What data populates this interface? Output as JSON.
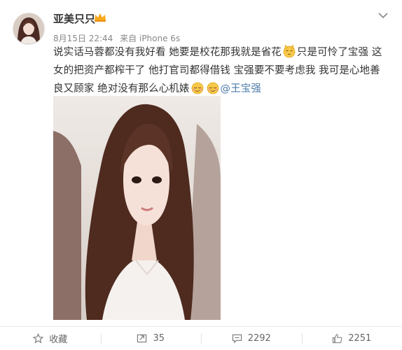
{
  "header": {
    "username": "亚美只只",
    "date": "8月15日 22:44",
    "source_prefix": "来自",
    "source": "iPhone 6s"
  },
  "post": {
    "segments": [
      {
        "text": "说实话马蓉都没有我好看  她要是校花那我就是省花"
      },
      {
        "emoji": "cat-face-icon"
      },
      {
        "text": "只是可怜了宝强  这女的把资产都榨干了  他打官司都得借钱  宝强要不要考虑我  我可是心地善良又顾家  绝对没有那么心机婊"
      },
      {
        "emoji": "smirk-face-icon"
      },
      {
        "emoji": "smirk-face-icon"
      },
      {
        "mention": "@王宝强"
      }
    ]
  },
  "actions": {
    "favorite": "收藏",
    "repost": "35",
    "comment": "2292",
    "like": "2251"
  },
  "colors": {
    "link": "#4a7aa8",
    "text": "#333333",
    "meta": "#888888"
  }
}
